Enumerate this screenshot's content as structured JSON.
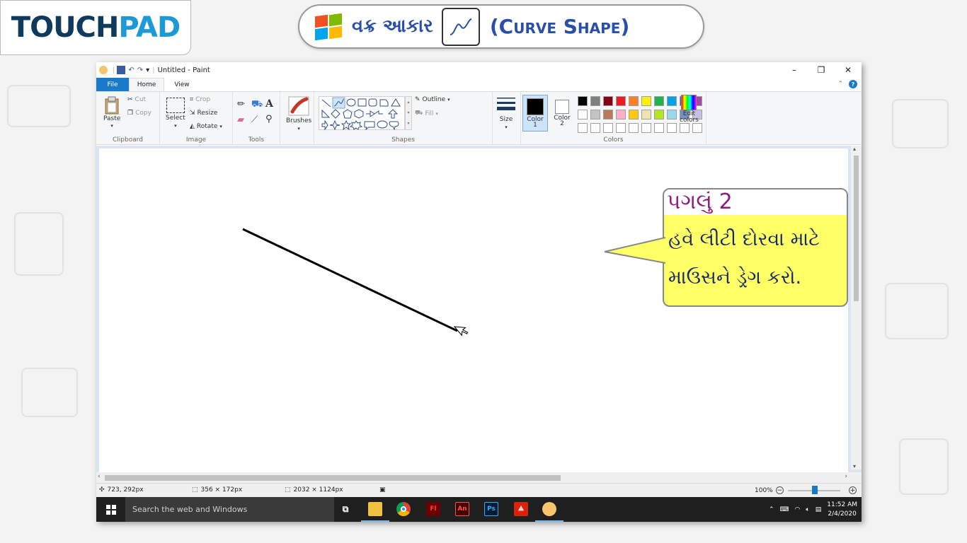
{
  "banner": {
    "logo": "TOUCHPAD",
    "logo_touch": "TOUCH",
    "logo_pad": "PAD",
    "title_gujarati": "વક્ર આકાર",
    "title_english": "(Curve Shape)"
  },
  "window": {
    "title": "Untitled - Paint",
    "controls": {
      "minimize": "–",
      "restore": "❐",
      "close": "✕"
    }
  },
  "tabs": {
    "file": "File",
    "home": "Home",
    "view": "View"
  },
  "ribbon": {
    "clipboard": {
      "paste": "Paste",
      "cut": "Cut",
      "copy": "Copy",
      "label": "Clipboard"
    },
    "image": {
      "select": "Select",
      "crop": "Crop",
      "resize": "Resize",
      "rotate": "Rotate",
      "label": "Image"
    },
    "tools": {
      "label": "Tools"
    },
    "brushes": {
      "label": "Brushes"
    },
    "shapes": {
      "outline": "Outline",
      "fill": "Fill",
      "label": "Shapes"
    },
    "size": {
      "label": "Size"
    },
    "colors": {
      "color1": "Color",
      "color1_num": "1",
      "color2": "Color",
      "color2_num": "2",
      "edit": "Edit",
      "edit2": "colors",
      "label": "Colors",
      "palette_row1": [
        "#000000",
        "#7f7f7f",
        "#880015",
        "#ed1c24",
        "#ff7f27",
        "#fff200",
        "#22b14c",
        "#00a2e8",
        "#3f48cc",
        "#a349a4"
      ],
      "palette_row2": [
        "#ffffff",
        "#c3c3c3",
        "#b97a57",
        "#ffaec9",
        "#ffc90e",
        "#efe4b0",
        "#b5e61d",
        "#99d9ea",
        "#7092be",
        "#c8bfe7"
      ]
    }
  },
  "status": {
    "cursor_pos": "723, 292px",
    "selection_size": "356 × 172px",
    "canvas_size": "2032 × 1124px",
    "zoom": "100%"
  },
  "taskbar": {
    "search_placeholder": "Search the web and Windows",
    "time": "11:52 AM",
    "date": "2/4/2020"
  },
  "callout": {
    "step": "પગલું 2",
    "line1": "હવે લીટી દોરવા માટે",
    "line2": "માઉસને ડ્રેગ કરો."
  }
}
